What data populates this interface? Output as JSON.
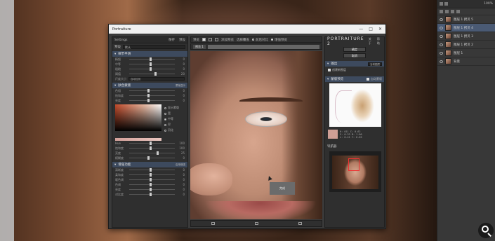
{
  "window": {
    "title": "Portraiture",
    "controls": [
      "—",
      "□",
      "✕"
    ]
  },
  "left_panel": {
    "header": "Settings",
    "header_btns": [
      "保存",
      "预设"
    ],
    "preset_label": "预设",
    "preset_value": "默认",
    "detail_section": {
      "title": "细节平滑",
      "sliders": [
        {
          "label": "精细",
          "value": "0",
          "pos": 0.45
        },
        {
          "label": "中等",
          "value": "0",
          "pos": 0.45
        },
        {
          "label": "粗糙",
          "value": "0",
          "pos": 0.45
        },
        {
          "label": "阈值",
          "value": "20",
          "pos": 0.55
        }
      ],
      "mode_label": "尺度大小",
      "mode_value": "自动检测"
    },
    "mask_section": {
      "title": "肤色蒙版",
      "dd": "蒙版显示",
      "sliders": [
        {
          "label": "色相",
          "value": "0",
          "pos": 0.4
        },
        {
          "label": "饱和度",
          "value": "0",
          "pos": 0.4
        },
        {
          "label": "亮度",
          "value": "0",
          "pos": 0.4
        }
      ],
      "radios": [
        {
          "label": "显示蒙版",
          "on": false
        },
        {
          "label": "宽",
          "on": false
        },
        {
          "label": "中等",
          "on": true
        },
        {
          "label": "窄",
          "on": false
        },
        {
          "label": "羽化",
          "on": false
        }
      ],
      "sliders2": [
        {
          "label": "Hue",
          "value": "100",
          "pos": 0.45
        },
        {
          "label": "饱和度",
          "value": "100",
          "pos": 0.45
        },
        {
          "label": "亮度",
          "value": "25",
          "pos": 0.6
        },
        {
          "label": "模糊度",
          "value": "0",
          "pos": 0.4
        }
      ]
    },
    "enhance_section": {
      "title": "增强功能",
      "check": "启用增强",
      "sliders": [
        {
          "label": "清晰度",
          "value": "0",
          "pos": 0.45
        },
        {
          "label": "柔和度",
          "value": "0",
          "pos": 0.45
        },
        {
          "label": "暖色调",
          "value": "0",
          "pos": 0.45
        },
        {
          "label": "色调",
          "value": "0",
          "pos": 0.45
        },
        {
          "label": "亮度",
          "value": "0",
          "pos": 0.45
        },
        {
          "label": "对比度",
          "value": "0",
          "pos": 0.45
        }
      ]
    }
  },
  "preview": {
    "toolbar_label": "预览",
    "btns": [
      "添加预览",
      "选择覆盖",
      "前后对比",
      "增强预览"
    ],
    "tag": "预览 1",
    "tooltip": "完成"
  },
  "right_panel": {
    "brand": "PORTRAITURE 2",
    "links": [
      "关于",
      "帮助"
    ],
    "ok": "确定",
    "cancel": "取消",
    "output_title": "输出",
    "output_dd": "当前图层",
    "output_check": "创建新图层",
    "mask_title": "蒙版预览",
    "mask_check": "自动蒙版",
    "sample_text": [
      "H: 011  C: 0.62",
      "S: 0.33  M: 1.00",
      "L: 0.41  Y: 0.65"
    ],
    "nav_title": "导航器"
  },
  "ps_panel": {
    "zoom": "100%",
    "layers": [
      {
        "name": "图层 1 拷贝 5",
        "sel": false
      },
      {
        "name": "图层 1 拷贝 4",
        "sel": true
      },
      {
        "name": "图层 1 拷贝 3",
        "sel": false
      },
      {
        "name": "图层 1 拷贝 2",
        "sel": false
      },
      {
        "name": "图层 1",
        "sel": false
      },
      {
        "name": "背景",
        "sel": false
      }
    ]
  }
}
